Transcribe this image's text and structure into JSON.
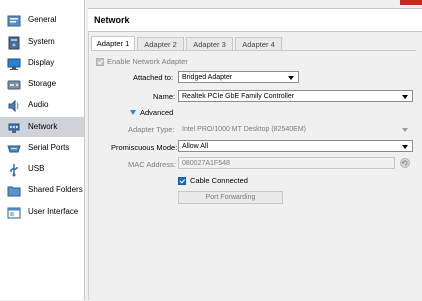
{
  "header": {
    "title": "Network"
  },
  "sidebar": {
    "items": [
      {
        "label": "General",
        "icon": "general-icon"
      },
      {
        "label": "System",
        "icon": "system-icon"
      },
      {
        "label": "Display",
        "icon": "display-icon"
      },
      {
        "label": "Storage",
        "icon": "storage-icon"
      },
      {
        "label": "Audio",
        "icon": "audio-icon"
      },
      {
        "label": "Network",
        "icon": "network-icon",
        "selected": true
      },
      {
        "label": "Serial Ports",
        "icon": "serial-ports-icon"
      },
      {
        "label": "USB",
        "icon": "usb-icon"
      },
      {
        "label": "Shared Folders",
        "icon": "shared-folders-icon"
      },
      {
        "label": "User Interface",
        "icon": "user-interface-icon"
      }
    ]
  },
  "tabs": [
    {
      "label": "Adapter 1",
      "active": true
    },
    {
      "label": "Adapter 2"
    },
    {
      "label": "Adapter 3"
    },
    {
      "label": "Adapter 4"
    }
  ],
  "form": {
    "enable_adapter_label": "Enable Network Adapter",
    "attached_to_label": "Attached to:",
    "attached_to_value": "Bridged Adapter",
    "name_label": "Name:",
    "name_value": "Realtek PCIe GbE Family Controller",
    "advanced_label": "Advanced",
    "adapter_type_label": "Adapter Type:",
    "adapter_type_value": "Intel PRO/1000 MT Desktop (82540EM)",
    "promiscuous_label": "Promiscuous Mode:",
    "promiscuous_value": "Allow All",
    "mac_label": "MAC Address:",
    "mac_value": "080027A1F548",
    "cable_connected_label": "Cable Connected",
    "port_forwarding_label": "Port Forwarding"
  },
  "colors": {
    "accent": "#1e6dc8",
    "selected_bg": "#cfd3d9",
    "close_button": "#c42b1c"
  }
}
